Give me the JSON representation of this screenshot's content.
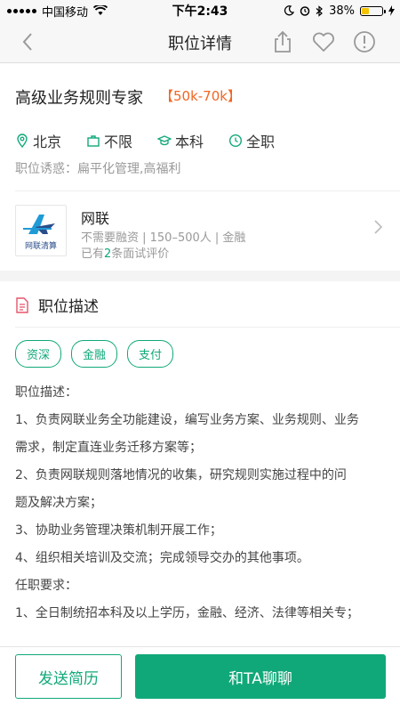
{
  "status_bar": {
    "carrier": "中国移动",
    "time": "下午2:43",
    "battery": "38%",
    "battery_level": 0.38
  },
  "nav": {
    "title": "职位详情",
    "icons": [
      "back-chevron",
      "share-icon",
      "heart-icon",
      "report-icon"
    ]
  },
  "job": {
    "title": "高级业务规则专家",
    "salary": "【50k-70k】",
    "location": "北京",
    "experience": "不限",
    "education": "本科",
    "type": "全职",
    "perks": "职位诱惑：扁平化管理,高福利"
  },
  "company": {
    "name": "网联",
    "logo_text": "网联清算",
    "meta": "不需要融资 | 150–500人 | 金融",
    "review_prefix": "已有",
    "review_count": "2",
    "review_suffix": "条面试评价"
  },
  "description": {
    "section_title": "职位描述",
    "tags": [
      "资深",
      "金融",
      "支付"
    ],
    "lines": [
      "职位描述：",
      "1、负责网联业务全功能建设，编写业务方案、业务规则、业务",
      "需求，制定直连业务迁移方案等；",
      "2、负责网联规则落地情况的收集，研究规则实施过程中的问",
      "题及解决方案；",
      "3、协助业务管理决策机制开展工作；",
      "4、组织相关培训及交流；完成领导交办的其他事项。",
      "任职要求：",
      "1、全日制统招本科及以上学历，金融、经济、法律等相关专；"
    ]
  },
  "bottom": {
    "resume_label": "发送简历",
    "chat_label": "和TA聊聊"
  },
  "colors": {
    "accent": "#11a879",
    "salary": "#f26522"
  }
}
